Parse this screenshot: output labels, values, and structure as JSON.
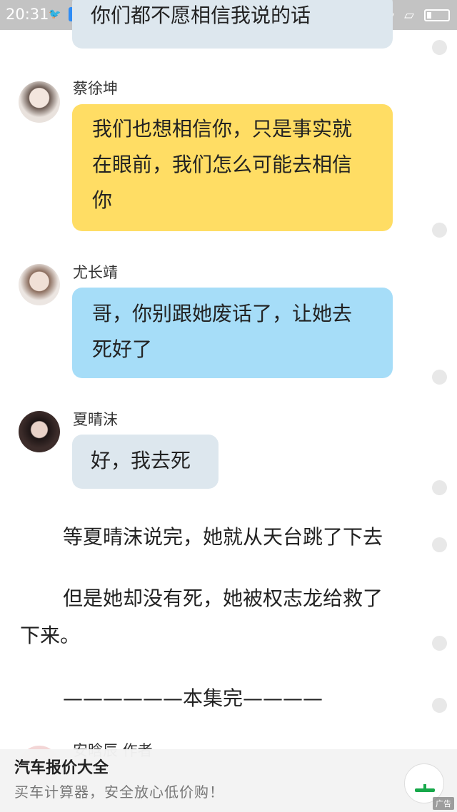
{
  "status_bar": {
    "time": "20:31"
  },
  "chat": {
    "top_bubble_text": "你们都不愿相信我说的话",
    "messages": [
      {
        "sender": "蔡徐坤",
        "text_lines": [
          "我们也想相信你，只是事实就",
          "在眼前，我们怎么可能去相信",
          "你"
        ]
      },
      {
        "sender": "尤长靖",
        "text_lines": [
          "哥，你别跟她废话了，让她去",
          "死好了"
        ]
      },
      {
        "sender": "夏晴沫",
        "text_lines": [
          "好，我去死"
        ]
      }
    ]
  },
  "narration": {
    "line1": "等夏晴沫说完，她就从天台跳了下去",
    "line2a": "但是她却没有死，她被权志龙给救了",
    "line2b": "下来。",
    "line3": "——————本集完————"
  },
  "author_row": {
    "partial_text": "安晗辰    作者"
  },
  "ad": {
    "title": "汽车报价大全",
    "subtitle": "买车计算器，安全放心低价购！",
    "tag": "广告"
  }
}
